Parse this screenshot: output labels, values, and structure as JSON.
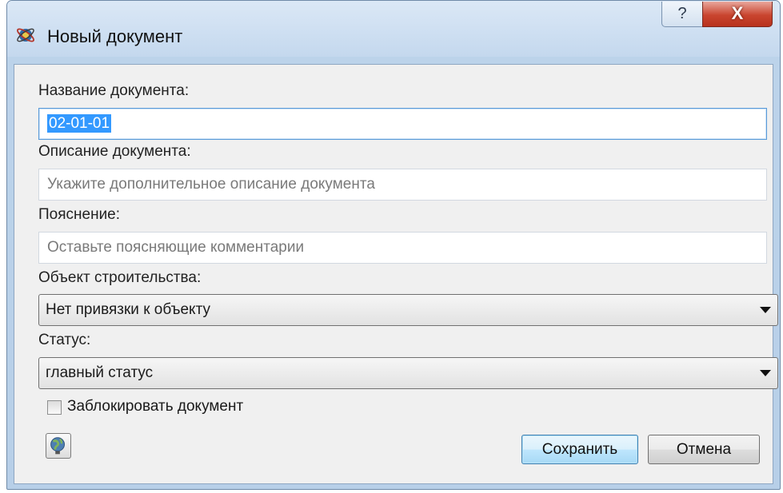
{
  "window": {
    "title": "Новый документ",
    "help_glyph": "?",
    "close_glyph": "X"
  },
  "form": {
    "doc_name_label": "Название документа:",
    "doc_name_value": "02-01-01",
    "description_label": "Описание документа:",
    "description_placeholder": "Укажите дополнительное описание документа",
    "note_label": "Пояснение:",
    "note_placeholder": "Оставьте поясняющие комментарии",
    "object_label": "Объект строительства:",
    "object_value": "Нет привязки к объекту",
    "status_label": "Статус:",
    "status_value": "главный статус",
    "lock_label": "Заблокировать документ",
    "lock_checked": false
  },
  "buttons": {
    "save": "Сохранить",
    "cancel": "Отмена",
    "globe_icon": "globe-icon"
  },
  "colors": {
    "selection": "#3399ff",
    "close_button": "#c9452f",
    "default_button_border": "#3c7fb1"
  }
}
